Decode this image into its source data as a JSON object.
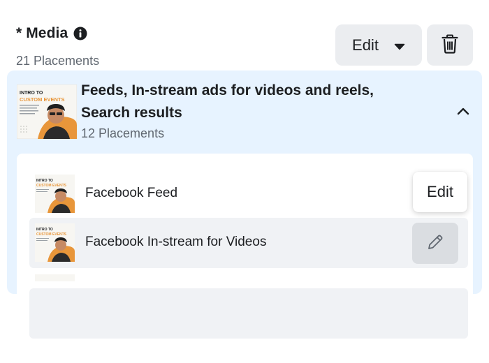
{
  "media": {
    "title": "* Media",
    "placements": "21 Placements",
    "edit_label": "Edit"
  },
  "group": {
    "title": "Feeds, In-stream ads for videos and reels, Search results",
    "placements": "12 Placements",
    "thumb_text_line1": "INTRO TO",
    "thumb_text_line2": "CUSTOM EVENTS"
  },
  "placements_list": [
    {
      "label": "Facebook Feed"
    },
    {
      "label": "Facebook In-stream for Videos"
    }
  ],
  "tooltip": {
    "label": "Edit"
  },
  "icons": {
    "info": "info-icon",
    "dropdown": "caret-down-icon",
    "trash": "trash-icon",
    "collapse": "chevron-up-icon",
    "edit": "pencil-icon"
  },
  "colors": {
    "panel_bg": "#e7f3ff",
    "button_bg": "#ebedf0",
    "hover_bg": "#f0f2f5",
    "thumb_orange": "#e8963a"
  }
}
